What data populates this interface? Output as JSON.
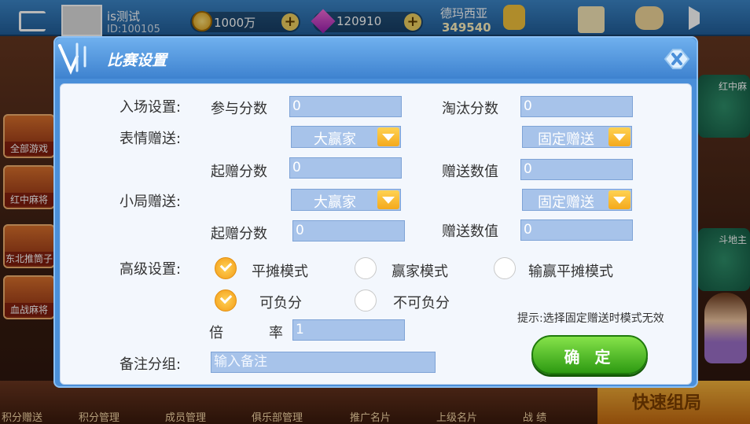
{
  "topbar": {
    "username": "is测试",
    "user_id": "ID:100105",
    "gold": "1000万",
    "diamonds": "120910",
    "club_name": "德玛西亚",
    "club_score": "349540"
  },
  "left_cards": [
    "全部游戏",
    "红中麻将",
    "东北推筒子",
    "血战麻将"
  ],
  "right_tables": [
    "红中麻",
    "斗地主"
  ],
  "bottom_nav": [
    "积分赠送",
    "积分管理",
    "成员管理",
    "俱乐部管理",
    "推广名片",
    "上级名片",
    "战 绩"
  ],
  "quick_button": "快速组局",
  "dialog": {
    "title": "比赛设置",
    "entry_label": "入场设置:",
    "participate_label": "参与分数",
    "participate_value": "0",
    "eliminate_label": "淘汰分数",
    "eliminate_value": "0",
    "emoji_label": "表情赠送:",
    "emoji_mode": "大赢家",
    "emoji_gift_type": "固定赠送",
    "emoji_start_label": "起赠分数",
    "emoji_start_value": "0",
    "emoji_gift_value_label": "赠送数值",
    "emoji_gift_value": "0",
    "round_label": "小局赠送:",
    "round_mode": "大赢家",
    "round_gift_type": "固定赠送",
    "round_start_label": "起赠分数",
    "round_start_value": "0",
    "round_gift_value_label": "赠送数值",
    "round_gift_value": "0",
    "advanced_label": "高级设置:",
    "mode_options": [
      "平摊模式",
      "赢家模式",
      "输赢平摊模式"
    ],
    "mode_selected": "平摊模式",
    "negative_options": [
      "可负分",
      "不可负分"
    ],
    "negative_selected": "可负分",
    "rate_char1": "倍",
    "rate_char2": "率",
    "rate_value": "1",
    "hint": "提示:选择固定赠送时模式无效",
    "remark_label": "备注分组:",
    "remark_placeholder": "输入备注",
    "confirm_label": "确 定"
  },
  "colors": {
    "dialog_blue": "#4a8fd9",
    "input_blue": "#a7c3ea",
    "accent_orange": "#f4a91c",
    "confirm_green": "#2d9a12"
  }
}
